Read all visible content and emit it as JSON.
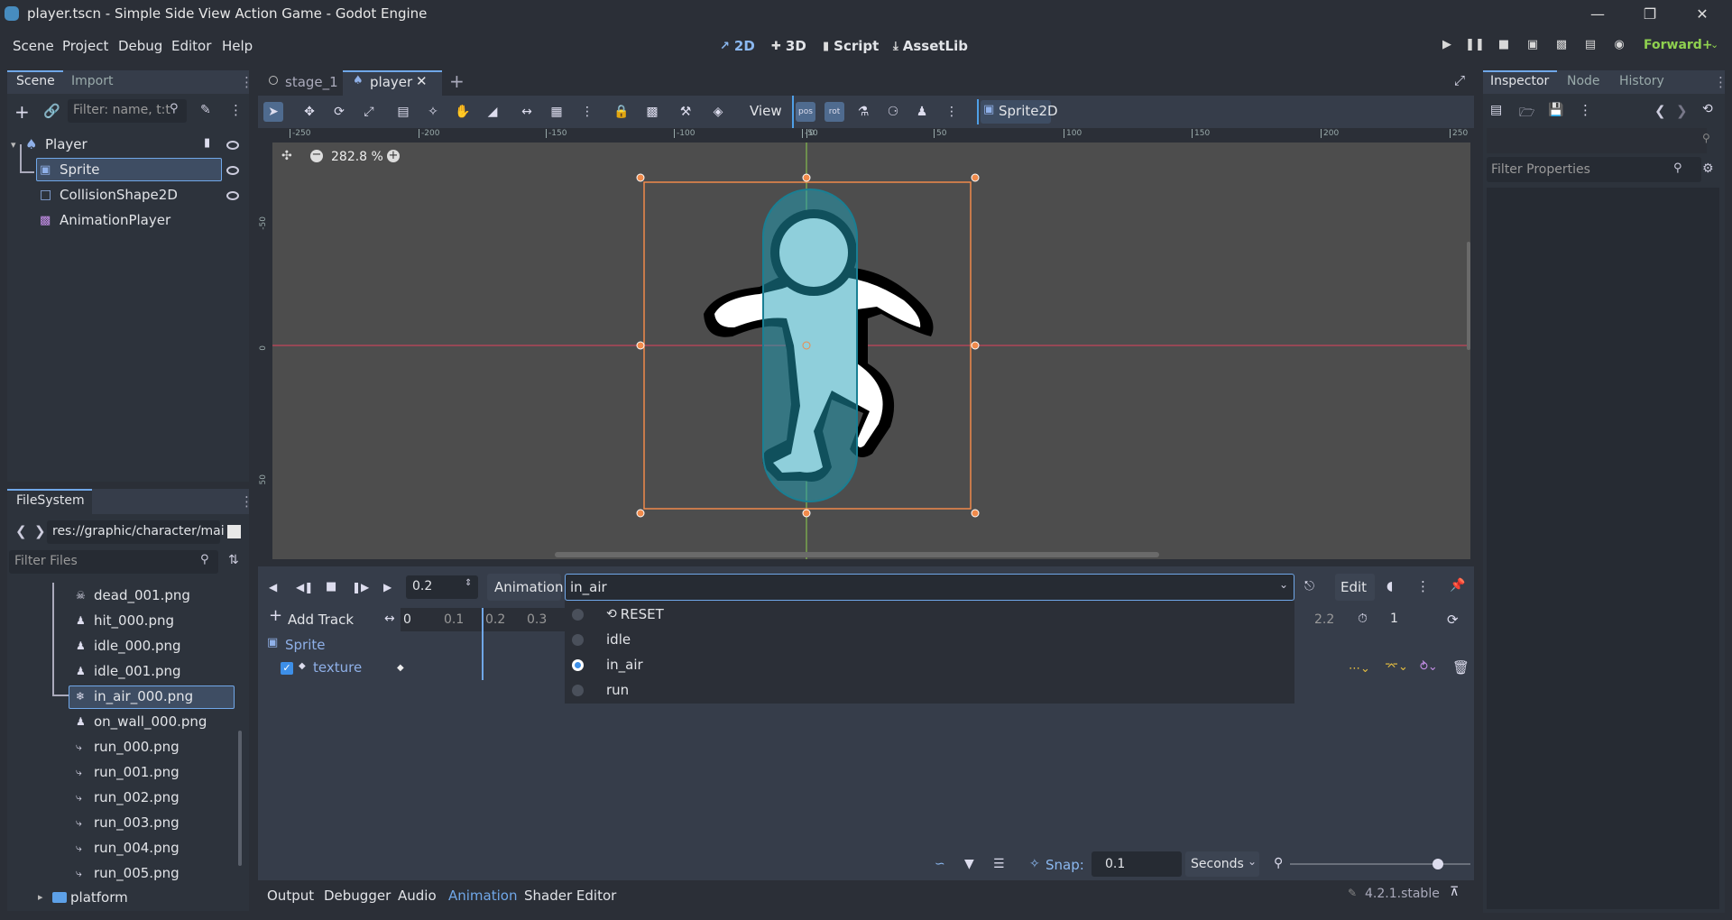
{
  "window": {
    "title": "player.tscn - Simple Side View Action Game - Godot Engine",
    "min_icon": "minimize-icon",
    "max_icon": "maximize-icon",
    "close_icon": "close-icon"
  },
  "menus": [
    "Scene",
    "Project",
    "Debug",
    "Editor",
    "Help"
  ],
  "main_screens": [
    {
      "label": "2D",
      "active": true
    },
    {
      "label": "3D"
    },
    {
      "label": "Script"
    },
    {
      "label": "AssetLib"
    }
  ],
  "renderer": "Forward+",
  "scene_dock": {
    "tabs": [
      "Scene",
      "Import"
    ],
    "filter_placeholder": "Filter: name, t:t",
    "tree": [
      {
        "label": "Player",
        "depth": 0,
        "icon": "player-node-icon",
        "color": "#8fb0e8"
      },
      {
        "label": "Sprite",
        "depth": 1,
        "icon": "sprite-icon",
        "selected": true,
        "color": "#8fb0e8"
      },
      {
        "label": "CollisionShape2D",
        "depth": 1,
        "icon": "collision-shape-icon",
        "color": "#8fb0e8"
      },
      {
        "label": "AnimationPlayer",
        "depth": 1,
        "icon": "animation-player-icon",
        "color": "#c58fe8"
      }
    ]
  },
  "filesystem": {
    "tab": "FileSystem",
    "path": "res://graphic/character/mai",
    "filter_placeholder": "Filter Files",
    "files": [
      "dead_001.png",
      "hit_000.png",
      "idle_000.png",
      "idle_001.png",
      "in_air_000.png",
      "on_wall_000.png",
      "run_000.png",
      "run_001.png",
      "run_002.png",
      "run_003.png",
      "run_004.png",
      "run_005.png"
    ],
    "selected_file": "in_air_000.png",
    "folder": "platform"
  },
  "editor_tabs": [
    {
      "label": "stage_1"
    },
    {
      "label": "player",
      "active": true
    }
  ],
  "toolbar": {
    "view_label": "View",
    "node_label": "Sprite2D",
    "pos_label": "pos",
    "rot_label": "rot"
  },
  "viewport": {
    "zoom": "282.8 %",
    "ruler_labels": [
      "-250",
      "-200",
      "-150",
      "-100",
      "-50",
      "0",
      "50",
      "100",
      "150",
      "200",
      "250"
    ],
    "vruler_labels": [
      "-50",
      "0",
      "50"
    ]
  },
  "animation_panel": {
    "time_value": "0.2",
    "animation_label": "Animation",
    "current_animation": "in_air",
    "edit_label": "Edit",
    "add_track_label": "Add Track",
    "timeline_ticks": [
      "0",
      "0.1",
      "0.2",
      "0.3"
    ],
    "end_tick": "2.2",
    "length_value": "1",
    "track_group": "Sprite",
    "track": "texture",
    "dropdown": [
      {
        "label": "RESET",
        "icon": "reset-icon"
      },
      {
        "label": "idle"
      },
      {
        "label": "in_air",
        "selected": true
      },
      {
        "label": "run"
      }
    ],
    "snap_label": "Snap:",
    "snap_value": "0.1",
    "snap_unit": "Seconds",
    "zoom_level": 0.82
  },
  "bottom_tabs": [
    {
      "label": "Output"
    },
    {
      "label": "Debugger"
    },
    {
      "label": "Audio"
    },
    {
      "label": "Animation",
      "active": true
    },
    {
      "label": "Shader Editor"
    }
  ],
  "version": "4.2.1.stable",
  "inspector": {
    "tabs": [
      {
        "label": "Inspector",
        "active": true
      },
      {
        "label": "Node"
      },
      {
        "label": "History"
      }
    ],
    "filter_placeholder": "Filter Properties"
  },
  "colors": {
    "accent": "#70a7e8",
    "selection_orange": "#f08a4b",
    "capsule": "#1f9fb7",
    "axis_red": "#e0445d",
    "axis_green": "#8fd14f"
  }
}
